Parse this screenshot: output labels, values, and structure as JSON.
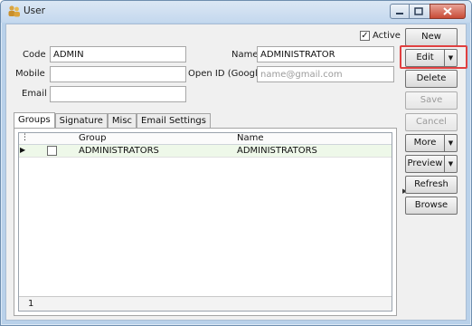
{
  "window": {
    "title": "User",
    "icon": "user-group-icon"
  },
  "form": {
    "active_label": "Active",
    "active_checked": true,
    "code_label": "Code",
    "code_value": "ADMIN",
    "name_label": "Name",
    "name_value": "ADMINISTRATOR",
    "mobile_label": "Mobile",
    "mobile_value": "",
    "openid_label": "Open ID (Google)",
    "openid_placeholder": "name@gmail.com",
    "email_label": "Email",
    "email_value": ""
  },
  "tabs": [
    "Groups",
    "Signature",
    "Misc",
    "Email Settings"
  ],
  "grid": {
    "columns": [
      "Group",
      "Name"
    ],
    "rows": [
      {
        "checked": false,
        "group": "ADMINISTRATORS",
        "name": "ADMINISTRATORS"
      }
    ],
    "footer_count": "1"
  },
  "actions": {
    "new": "New",
    "edit": "Edit",
    "delete": "Delete",
    "save": "Save",
    "cancel": "Cancel",
    "more": "More",
    "preview": "Preview",
    "refresh": "Refresh",
    "browse": "Browse"
  },
  "colors": {
    "highlight": "#e04040",
    "selected_row": "#eef8e9"
  }
}
